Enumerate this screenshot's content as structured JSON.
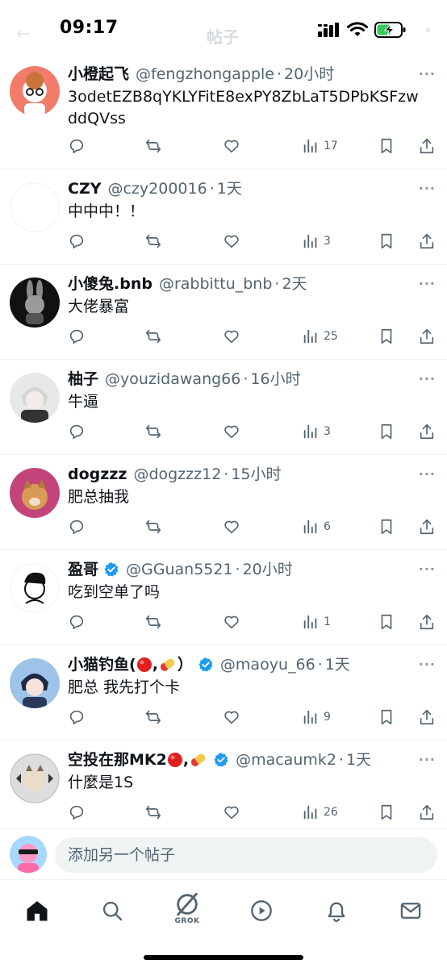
{
  "status_bar": {
    "time": "09:17"
  },
  "header": {
    "title": "帖子"
  },
  "posts": [
    {
      "name": "小橙起飞",
      "handle": "@fengzhongapple",
      "sep": "·",
      "time": "20小时",
      "text": "3odetEZB8qYKLYFitE8exPY8ZbLaT5DPbKSFzwddQVss",
      "views": "17",
      "verified": false
    },
    {
      "name": "CZY",
      "handle": "@czy200016",
      "sep": "·",
      "time": "1天",
      "text": "中中中！！",
      "views": "3",
      "verified": false
    },
    {
      "name": "小傻兔.bnb",
      "handle": "@rabbittu_bnb",
      "sep": "·",
      "time": "2天",
      "text": "大佬暴富",
      "views": "25",
      "verified": false
    },
    {
      "name": "柚子",
      "handle": "@youzidawang66",
      "sep": "·",
      "time": "16小时",
      "text": "牛逼",
      "views": "3",
      "verified": false
    },
    {
      "name": "dogzzz",
      "handle": "@dogzzz12",
      "sep": "·",
      "time": "15小时",
      "text": "肥总抽我",
      "views": "6",
      "verified": false
    },
    {
      "name": "盈哥",
      "handle": "@GGuan5521",
      "sep": "·",
      "time": "20小时",
      "text": "吃到空单了吗",
      "views": "1",
      "verified": true
    },
    {
      "name": "小猫钓鱼(",
      "name_suffix": "）",
      "handle": "@maoyu_66",
      "sep": "·",
      "time": "1天",
      "text": "肥总 我先打个卡",
      "views": "9",
      "verified": true
    },
    {
      "name": "空投在那MK2",
      "name_suffix": "",
      "handle": "@macaumk2",
      "sep": "·",
      "time": "1天",
      "text": "什麼是1S",
      "views": "26",
      "verified": true
    }
  ],
  "reply": {
    "placeholder": "添加另一个帖子"
  },
  "tabs": {
    "grok_label": "GROK"
  },
  "colors": {
    "accent": "#1d9bf0",
    "secondary_text": "#536471",
    "divider": "#eff3f4"
  },
  "icons": [
    "reply-icon",
    "repost-icon",
    "like-icon",
    "views-icon",
    "bookmark-icon",
    "share-icon",
    "home-icon",
    "search-icon",
    "grok-icon",
    "video-icon",
    "notifications-icon",
    "messages-icon"
  ]
}
